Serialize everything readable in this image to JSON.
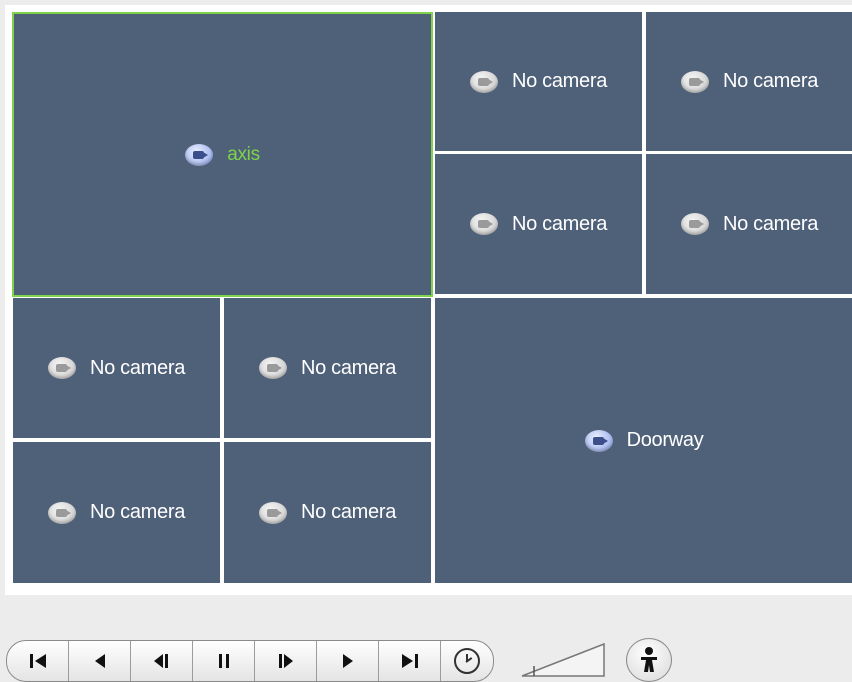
{
  "grid": {
    "main_tile": {
      "label": "axis",
      "state": "selected",
      "icon": "camera-icon"
    },
    "tiles": [
      {
        "id": "t1",
        "label": "No camera",
        "icon": "camera-icon"
      },
      {
        "id": "t2",
        "label": "No camera",
        "icon": "camera-icon"
      },
      {
        "id": "t3",
        "label": "No camera",
        "icon": "camera-icon"
      },
      {
        "id": "t4",
        "label": "No camera",
        "icon": "camera-icon"
      },
      {
        "id": "t5",
        "label": "No camera",
        "icon": "camera-icon"
      },
      {
        "id": "t6",
        "label": "No camera",
        "icon": "camera-icon"
      },
      {
        "id": "t7",
        "label": "No camera",
        "icon": "camera-icon"
      },
      {
        "id": "t8",
        "label": "No camera",
        "icon": "camera-icon"
      }
    ],
    "large_tile": {
      "label": "Doorway",
      "icon": "camera-icon"
    },
    "colors": {
      "tile_bg": "#4f6079",
      "selected_border": "#7fd34a",
      "selected_text": "#7fd34a"
    }
  },
  "controls": {
    "buttons": [
      {
        "name": "first-frame",
        "glyph": "⏮"
      },
      {
        "name": "previous",
        "glyph": "◀"
      },
      {
        "name": "step-back",
        "glyph": "◀▮"
      },
      {
        "name": "pause",
        "glyph": "❚❚"
      },
      {
        "name": "step-forward",
        "glyph": "▮▶"
      },
      {
        "name": "play",
        "glyph": "▶"
      },
      {
        "name": "last-frame",
        "glyph": "⏭"
      }
    ],
    "clock_icon": "clock-icon",
    "volume_icon": "volume-slider-icon",
    "person_icon": "person-icon"
  }
}
